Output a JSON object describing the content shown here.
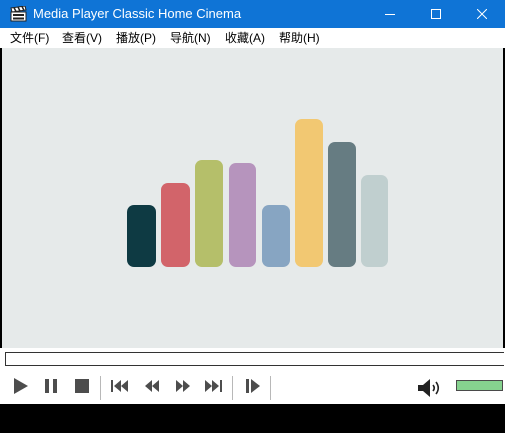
{
  "window": {
    "title": "Media Player Classic Home Cinema",
    "icons": {
      "app": "clapperboard-icon",
      "minimize": "minimize-icon",
      "maximize": "maximize-icon",
      "close": "close-icon"
    }
  },
  "menu": {
    "items": [
      "文件(F)",
      "查看(V)",
      "播放(P)",
      "导航(N)",
      "收藏(A)",
      "帮助(H)"
    ]
  },
  "video": {
    "content": "logo-bars",
    "bar_colors": [
      "#0e3a43",
      "#d2646a",
      "#b5bf6a",
      "#b694bd",
      "#87a5c2",
      "#f2c872",
      "#667c82",
      "#c0cfcf"
    ],
    "background": "#e6eaea"
  },
  "seekbar": {
    "position": 0
  },
  "controls": {
    "icons": [
      "play-icon",
      "pause-icon",
      "stop-icon",
      "skip-back-icon",
      "rewind-icon",
      "fast-forward-icon",
      "skip-forward-icon",
      "frame-step-icon"
    ]
  },
  "volume": {
    "level": 1.0,
    "color": "#86d28f",
    "icon": "speaker-icon"
  },
  "colors": {
    "titlebar": "#0f74d6",
    "controls": "#4d4d4d"
  }
}
